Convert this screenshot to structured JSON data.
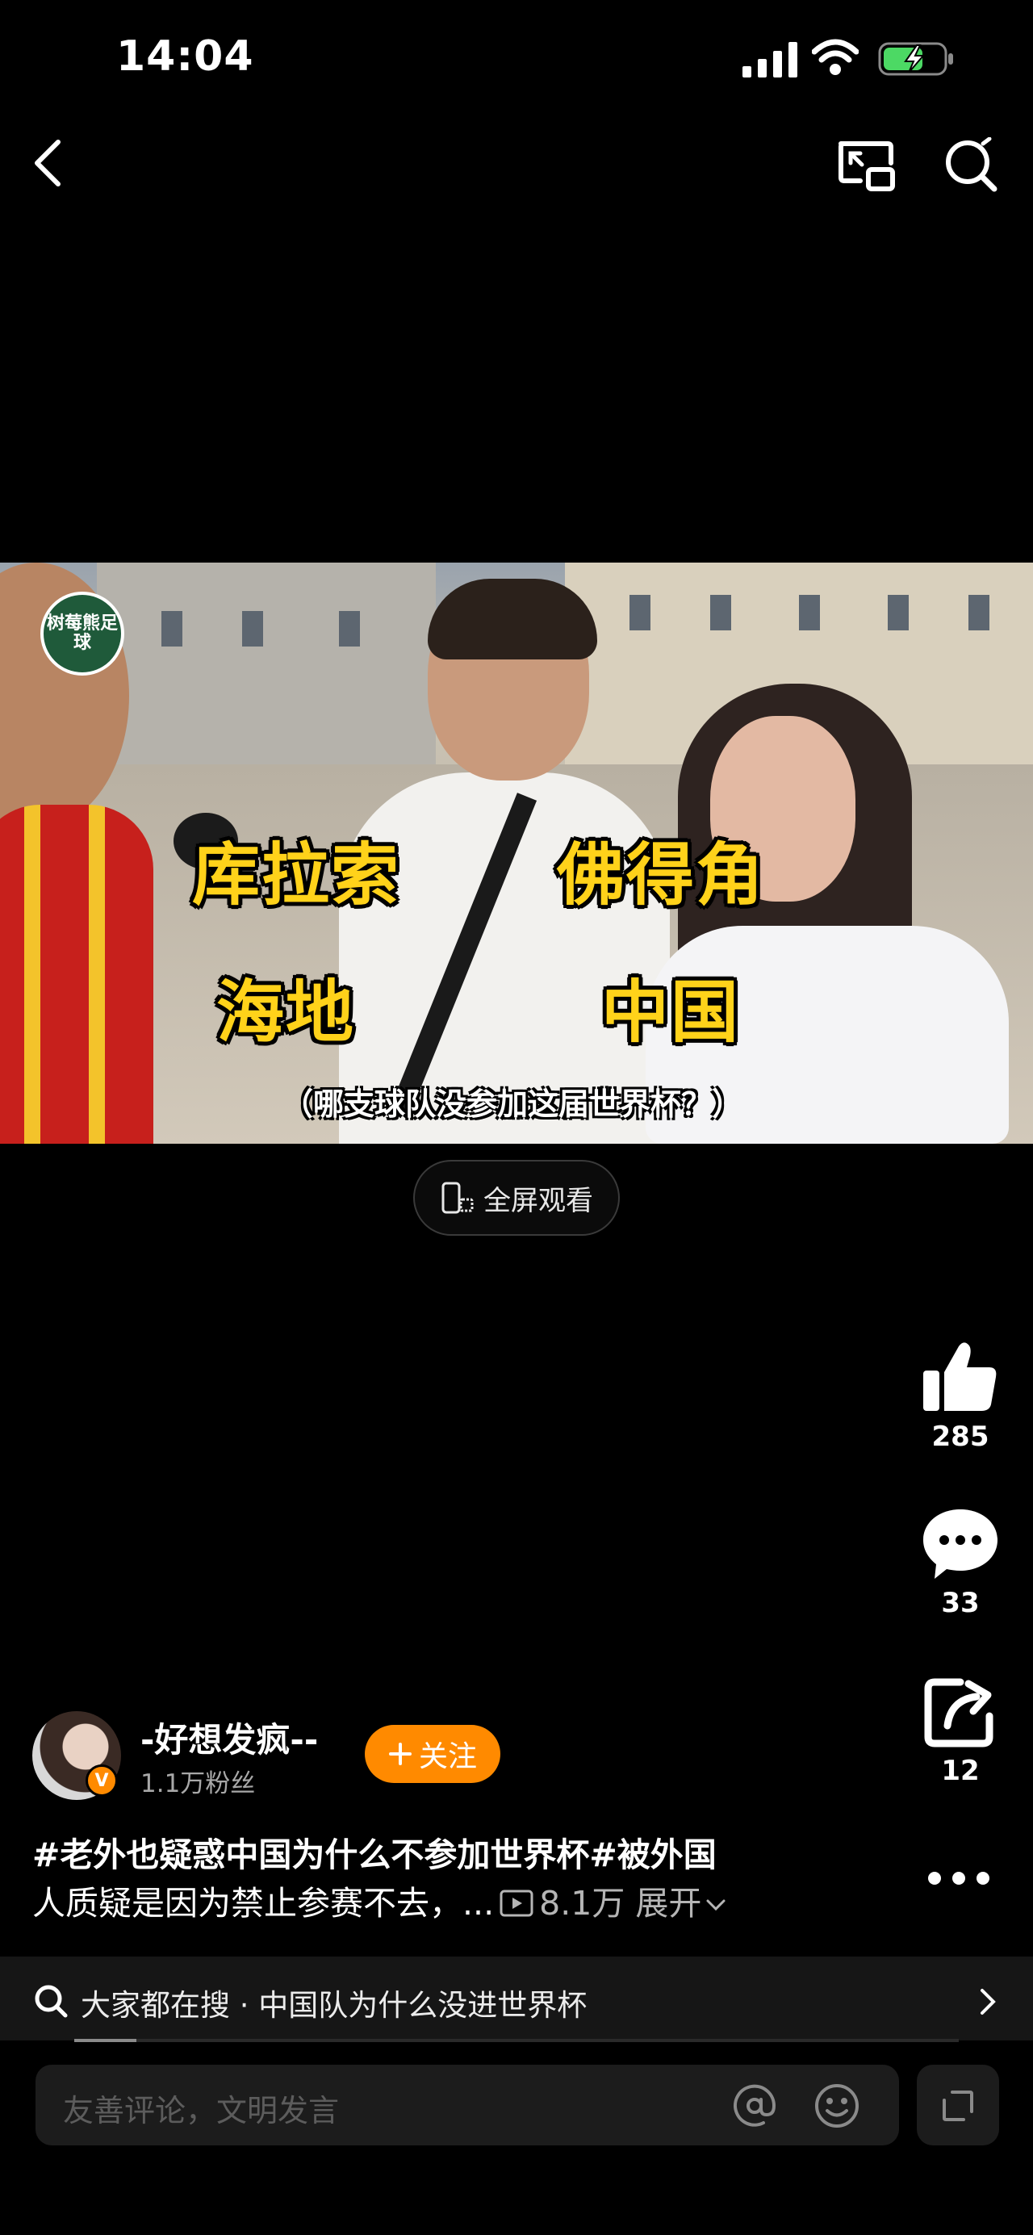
{
  "status_bar": {
    "time": "14:04"
  },
  "video": {
    "channel_logo": "树莓熊足球",
    "captions": [
      "库拉索",
      "佛得角",
      "海地",
      "中国"
    ],
    "subtitle": "（哪支球队没参加这届世界杯？）",
    "fullscreen_label": "全屏观看"
  },
  "actions": {
    "likes": "285",
    "comments": "33",
    "shares": "12"
  },
  "author": {
    "name": "-好想发疯--",
    "followers": "1.1万粉丝",
    "follow_label": "关注",
    "badge": "V"
  },
  "description": {
    "line1": "#老外也疑惑中国为什么不参加世界杯#被外国",
    "line2_text": "人质疑是因为禁止参赛不去，...",
    "views": "8.1万",
    "expand": "展开"
  },
  "search": {
    "text": "大家都在搜 · 中国队为什么没进世界杯",
    "progress": 0.07
  },
  "comment": {
    "placeholder": "友善评论，文明发言"
  },
  "icons": [
    "back-icon",
    "pip-icon",
    "search-icon",
    "like-icon",
    "comment-icon",
    "share-icon",
    "more-icon",
    "at-icon",
    "emoji-icon",
    "expand-icon"
  ],
  "colors": {
    "accent": "#ff8a00",
    "caption_yellow": "#ffd21a",
    "battery_green": "#4cd964"
  }
}
